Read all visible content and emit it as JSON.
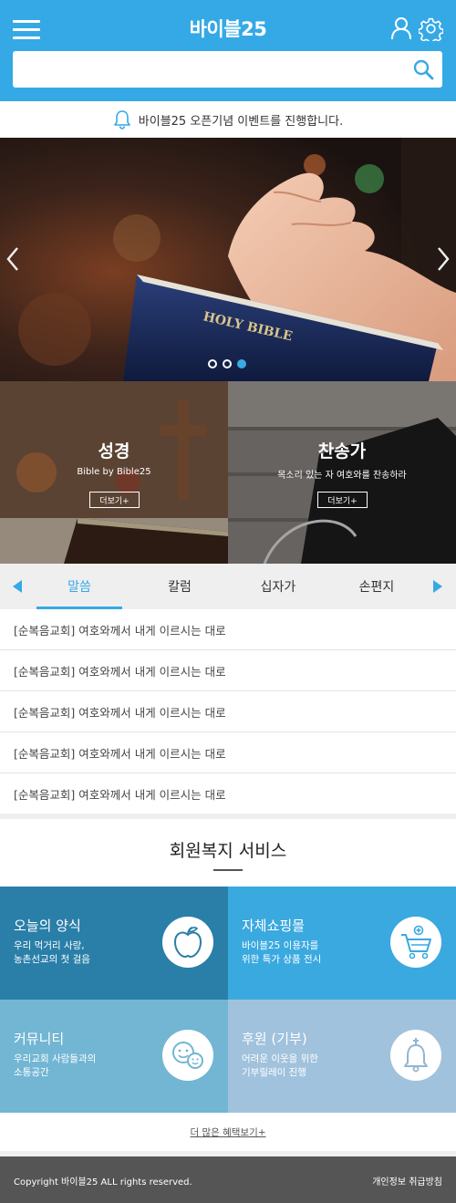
{
  "header": {
    "brand": "바이블25",
    "search_placeholder": ""
  },
  "notice": {
    "text": "바이블25 오픈기념 이벤트를 진행합니다."
  },
  "hero": {
    "slides_total": 3,
    "active_slide": 3,
    "book_text": "HOLY BIBLE"
  },
  "features": [
    {
      "title": "성경",
      "subtitle": "Bible by Bible25",
      "button": "더보기+"
    },
    {
      "title": "찬송가",
      "subtitle": "목소리 있는 자 여호와를 찬송하라",
      "button": "더보기+"
    }
  ],
  "tabs": {
    "items": [
      "말씀",
      "칼럼",
      "십자가",
      "손편지"
    ],
    "active": "말씀"
  },
  "list": [
    "[순복음교회] 여호와께서 내게 이르시는 대로",
    "[순복음교회] 여호와께서 내게 이르시는 대로",
    "[순복음교회] 여호와께서 내게 이르시는 대로",
    "[순복음교회] 여호와께서 내게 이르시는 대로",
    "[순복음교회] 여호와께서 내게 이르시는 대로"
  ],
  "services": {
    "title": "회원복지 서비스",
    "items": [
      {
        "name": "오늘의 양식",
        "desc": "우리 먹거리 사랑,\n농촌선교의 첫 걸음",
        "icon": "apple-icon",
        "color": "#2a7fa8"
      },
      {
        "name": "자체쇼핑몰",
        "desc": "바이블25 이용자를\n위한 특가 상품 전시",
        "icon": "cart-icon",
        "color": "#3aa9e0"
      },
      {
        "name": "커뮤니티",
        "desc": "우리교회 사람들과의\n소통공간",
        "icon": "smiley-icon",
        "color": "#72b6d3"
      },
      {
        "name": "후원 (기부)",
        "desc": "어려운 이웃을 위한\n기부릴레이 진행",
        "icon": "bell-icon",
        "color": "#a0c2dc"
      }
    ],
    "more": "더 많은 혜택보기+"
  },
  "footer": {
    "copyright": "Copyright 바이블25 ALL rights reserved.",
    "privacy": "개인정보 취급방침"
  },
  "colors": {
    "primary": "#35a9e6",
    "footer": "#555555",
    "tab_bg": "#efefef"
  }
}
